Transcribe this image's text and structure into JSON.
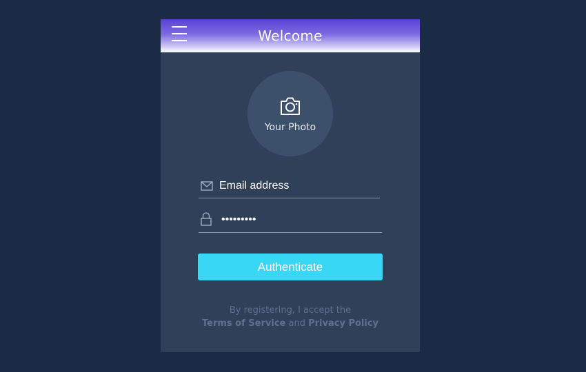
{
  "header": {
    "title": "Welcome",
    "menu_icon": "hamburger-menu-icon"
  },
  "photo": {
    "label": "Your Photo",
    "icon": "camera-icon"
  },
  "form": {
    "email_placeholder": "Email address",
    "email_icon": "envelope-icon",
    "password_value": "•••••••••",
    "password_icon": "lock-icon",
    "submit_label": "Authenticate"
  },
  "terms": {
    "line1": "By registering, I accept the",
    "tos_link": "Terms of Service",
    "and_text": "and",
    "privacy_link": "Privacy Policy"
  },
  "colors": {
    "background": "#1c2b45",
    "card": "#2f4059",
    "accent": "#38d7f6",
    "header_gradient_start": "#5b43d6"
  }
}
